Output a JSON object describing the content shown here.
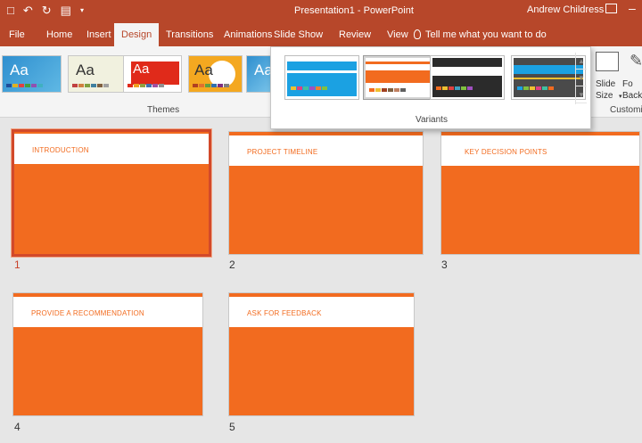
{
  "titlebar": {
    "document_title": "Presentation1  -  PowerPoint",
    "user_name": "Andrew Childress"
  },
  "tabs": [
    {
      "label": "File"
    },
    {
      "label": "Home"
    },
    {
      "label": "Insert"
    },
    {
      "label": "Design"
    },
    {
      "label": "Transitions"
    },
    {
      "label": "Animations"
    },
    {
      "label": "Slide Show"
    },
    {
      "label": "Review"
    },
    {
      "label": "View"
    }
  ],
  "active_tab": "Design",
  "tell_me": "Tell me what you want to do",
  "ribbon": {
    "themes_label": "Themes",
    "variants_label": "Variants",
    "slide_size_label": "Slide Size",
    "format_background_label": "Fo Back",
    "customize_label": "Customi",
    "theme_sample_text": "Aa"
  },
  "slides": [
    {
      "number": "1",
      "title": "INTRODUCTION",
      "selected": true
    },
    {
      "number": "2",
      "title": "PROJECT TIMELINE"
    },
    {
      "number": "3",
      "title": "KEY DECISION POINTS"
    },
    {
      "number": "4",
      "title": "PROVIDE A RECOMMENDATION"
    },
    {
      "number": "5",
      "title": "ASK FOR FEEDBACK"
    }
  ],
  "colors": {
    "accent": "#b7472a",
    "slide_orange": "#f26b1f"
  },
  "icons": {
    "save": "save-icon",
    "undo": "undo-icon",
    "redo": "redo-icon",
    "present": "present-from-beginning-icon",
    "customize_qat": "customize-qat-icon",
    "ribbon_options": "ribbon-display-options-icon",
    "tell_me": "lightbulb-icon"
  }
}
